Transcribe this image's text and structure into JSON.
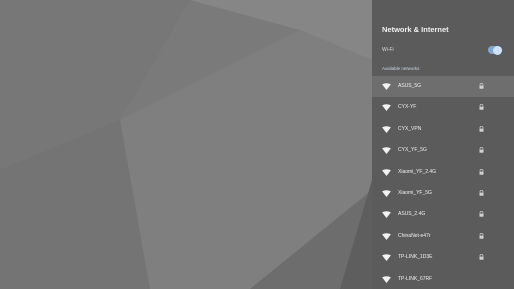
{
  "panel": {
    "title": "Network & Internet",
    "wifi_label": "Wi-Fi",
    "wifi_enabled": true,
    "section_label": "Available networks",
    "networks": [
      {
        "name": "ASUS_5G",
        "secured": true,
        "selected": true
      },
      {
        "name": "CYX-YF",
        "secured": true,
        "selected": false
      },
      {
        "name": "CYX_VPN",
        "secured": true,
        "selected": false
      },
      {
        "name": "CYX_YF_5G",
        "secured": true,
        "selected": false
      },
      {
        "name": "Xiaomi_YF_2.4G",
        "secured": true,
        "selected": false
      },
      {
        "name": "Xiaomi_YF_5G",
        "secured": true,
        "selected": false
      },
      {
        "name": "ASUS_2.4G",
        "secured": true,
        "selected": false
      },
      {
        "name": "ChinaNet-e47r",
        "secured": true,
        "selected": false
      },
      {
        "name": "TP-LINK_1D3E",
        "secured": true,
        "selected": false
      },
      {
        "name": "TP-LINK_67RF",
        "secured": false,
        "selected": false
      }
    ]
  },
  "colors": {
    "panel_bg": "#5b5b5b",
    "selected_row": "#6e6e6e",
    "toggle_track": "#7fa6d6",
    "toggle_knob": "#cfe3ff",
    "section_label": "#c8d6e8"
  },
  "icons": {
    "network": "wifi-icon",
    "secured": "lock-icon"
  }
}
